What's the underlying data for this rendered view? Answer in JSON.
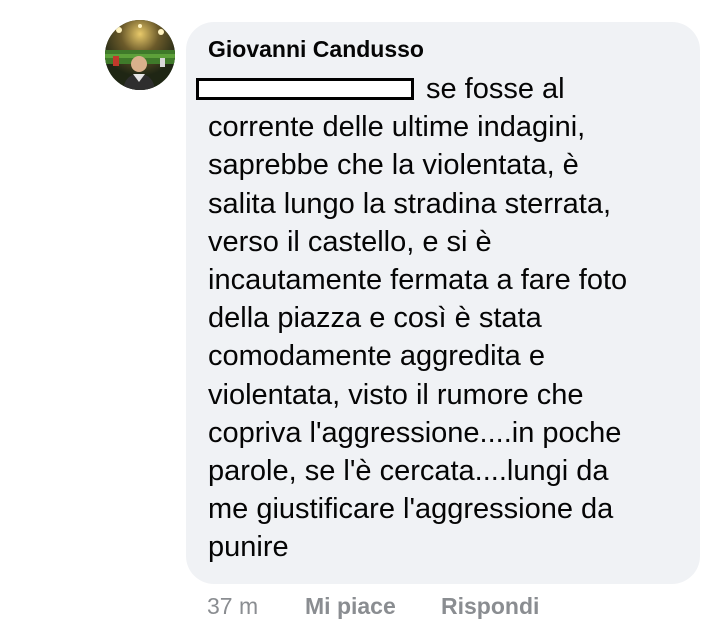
{
  "comment": {
    "author": "Giovanni Candusso",
    "lines": [
      "se fosse al",
      "corrente delle ultime indagini,",
      "saprebbe che la violentata, è",
      "salita lungo la stradina sterrata,",
      "verso il castello, e si è",
      "incautamente fermata a fare foto",
      "della piazza e così è stata",
      "comodamente aggredita e",
      "violentata, visto il rumore che",
      "copriva l'aggressione....in poche",
      "parole, se l'è cercata....lungi da",
      "me giustificare l'aggressione da",
      "punire"
    ],
    "timestamp": "37 m",
    "like_label": "Mi piace",
    "reply_label": "Rispondi"
  },
  "colors": {
    "bubble_bg": "#f0f2f5",
    "text": "#050505",
    "meta": "#8a8d91"
  }
}
